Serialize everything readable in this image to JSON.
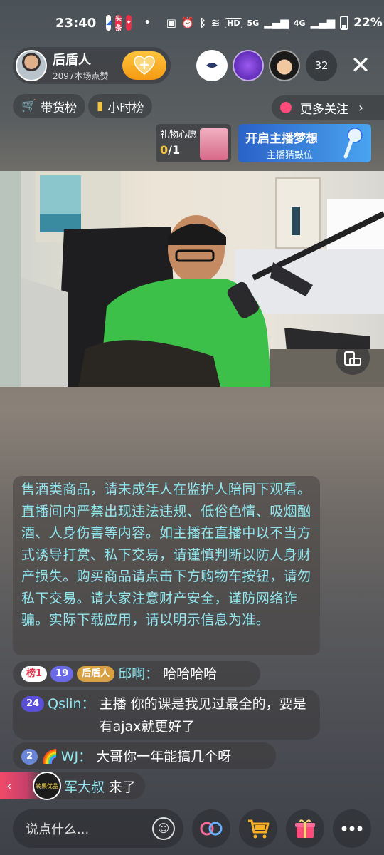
{
  "status_bar": {
    "time": "23:40",
    "app_icons": [
      "meitu-icon",
      "toutiao-icon",
      "douyin-mall-icon"
    ],
    "toutiao_label": "头条",
    "dot": "•",
    "network_label": "HD",
    "signal1": "5G",
    "signal2": "4G",
    "battery": "22%"
  },
  "host": {
    "name": "后盾人",
    "likes": "2097本场点赞",
    "follow_icon": "heart-plus-icon"
  },
  "viewers": {
    "count": "32",
    "colors": [
      "#ffffff",
      "#6a3ad0",
      "#2a2a2a"
    ]
  },
  "chips": {
    "goods_rank": "带货榜",
    "hour_rank": "小时榜",
    "more_follow": "更多关注"
  },
  "gift_wish": {
    "title": "礼物心愿",
    "current": "0",
    "total": "/1"
  },
  "dream": {
    "title": "开启主播梦想",
    "subtitle": "主播猜鼓位"
  },
  "notice": {
    "text": "售酒类商品，请未成年人在监护人陪同下观看。直播间内严禁出现违法违规、低俗色情、吸烟酗酒、人身伤害等内容。如主播在直播中以不当方式诱导打赏、私下交易，请谨慎判断以防人身财产损失。购买商品请点击下方购物车按钮，请勿私下交易。请大家注意财产安全，谨防网络诈骗。实际下载应用，请以明示信息为准。"
  },
  "messages": [
    {
      "badges": [
        {
          "label": "榜1",
          "bg": "#ffffff",
          "color": "#e8304a"
        },
        {
          "label": "19",
          "bg": "#6a6ae8",
          "color": "#ffffff"
        },
        {
          "label": "后盾人",
          "bg": "#d8a040",
          "color": "#ffffff"
        }
      ],
      "user": "邱啊：",
      "text": "哈哈哈哈"
    },
    {
      "badges": [
        {
          "label": "24",
          "bg": "#5a50d8",
          "color": "#ffffff"
        }
      ],
      "user": "Qslin：",
      "text": "主播 你的课是我见过最全的，要是有ajax就更好了"
    },
    {
      "badges": [
        {
          "label": "2",
          "bg": "#6a86d8",
          "color": "#ffffff"
        }
      ],
      "emoji": "🌈",
      "user": "WJ：",
      "text": "大哥你一年能搞几个呀"
    }
  ],
  "entry": {
    "back": "‹",
    "logo_text": "转果优品",
    "name": "军大叔",
    "action": "来了"
  },
  "bottom": {
    "placeholder": "说点什么...",
    "emoji_icon": "smile-icon",
    "buttons": [
      "link-icon",
      "cart-icon",
      "gift-icon",
      "more-icon"
    ]
  }
}
